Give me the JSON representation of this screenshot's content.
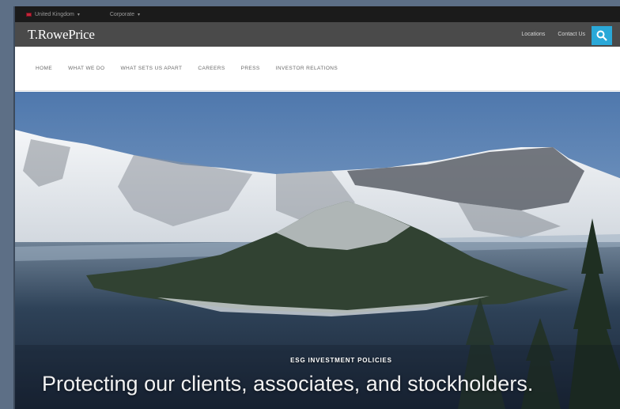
{
  "utility_bar": {
    "region": "United Kingdom",
    "audience": "Corporate"
  },
  "brand": {
    "logo": "T.RowePrice",
    "links": [
      "Locations",
      "Contact Us"
    ]
  },
  "nav": {
    "items": [
      "HOME",
      "WHAT WE DO",
      "WHAT SETS US APART",
      "CAREERS",
      "PRESS",
      "INVESTOR RELATIONS"
    ]
  },
  "hero": {
    "eyebrow": "ESG INVESTMENT POLICIES",
    "headline": "Protecting our clients, associates, and stockholders."
  },
  "colors": {
    "util_bar": "#1b1b1b",
    "brand_bar": "#4a4a4a",
    "accent": "#2aa8d8"
  }
}
